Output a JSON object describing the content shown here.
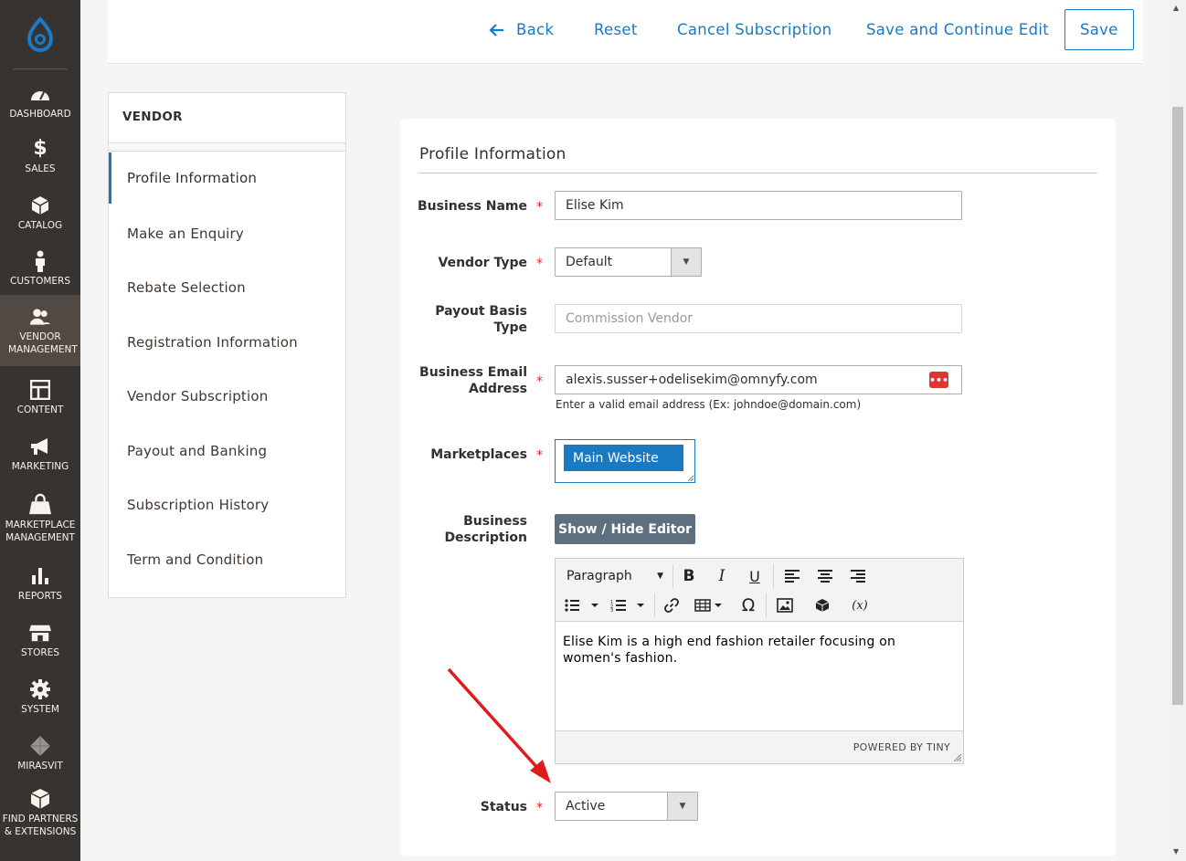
{
  "nav": {
    "items": [
      {
        "label": "DASHBOARD",
        "icon": "dashboard-icon"
      },
      {
        "label": "SALES",
        "icon": "dollar-icon"
      },
      {
        "label": "CATALOG",
        "icon": "box-icon"
      },
      {
        "label": "CUSTOMERS",
        "icon": "person-icon"
      },
      {
        "label": "VENDOR MANAGEMENT",
        "icon": "users-icon"
      },
      {
        "label": "CONTENT",
        "icon": "layout-icon"
      },
      {
        "label": "MARKETING",
        "icon": "megaphone-icon"
      },
      {
        "label": "MARKETPLACE MANAGEMENT",
        "icon": "shopping-bag-icon"
      },
      {
        "label": "REPORTS",
        "icon": "bar-chart-icon"
      },
      {
        "label": "STORES",
        "icon": "store-icon"
      },
      {
        "label": "SYSTEM",
        "icon": "gear-icon"
      },
      {
        "label": "MIRASVIT",
        "icon": "diamond-icon"
      },
      {
        "label": "FIND PARTNERS & EXTENSIONS",
        "icon": "cube-icon"
      }
    ],
    "active": "VENDOR MANAGEMENT"
  },
  "header": {
    "back": "Back",
    "reset": "Reset",
    "cancel_subscription": "Cancel Subscription",
    "save_continue": "Save and Continue Edit",
    "save": "Save"
  },
  "tabs": {
    "title": "VENDOR",
    "items": [
      "Profile Information",
      "Make an Enquiry",
      "Rebate Selection",
      "Registration Information",
      "Vendor Subscription",
      "Payout and Banking",
      "Subscription History",
      "Term and Condition"
    ],
    "active": "Profile Information"
  },
  "form": {
    "section_title": "Profile Information",
    "business_name": {
      "label": "Business Name",
      "value": "Elise Kim"
    },
    "vendor_type": {
      "label": "Vendor Type",
      "value": "Default"
    },
    "payout_basis": {
      "label_line1": "Payout Basis",
      "label_line2": "Type",
      "placeholder": "Commission Vendor"
    },
    "business_email": {
      "label_line1": "Business Email",
      "label_line2": "Address",
      "value": "alexis.susser+odelisekim@omnyfy.com",
      "note": "Enter a valid email address (Ex: johndoe@domain.com)",
      "badge": "•••"
    },
    "marketplaces": {
      "label": "Marketplaces",
      "selected": "Main Website"
    },
    "business_description": {
      "label_line1": "Business",
      "label_line2": "Description",
      "toggle_button": "Show / Hide Editor",
      "format": "Paragraph",
      "content": "Elise Kim is a high end fashion retailer focusing on women's fashion.",
      "powered": "POWERED BY TINY"
    },
    "status": {
      "label": "Status",
      "value": "Active"
    },
    "required_mark": "*"
  },
  "annotation_color": "#e01b1b",
  "accent": "#1979c3"
}
